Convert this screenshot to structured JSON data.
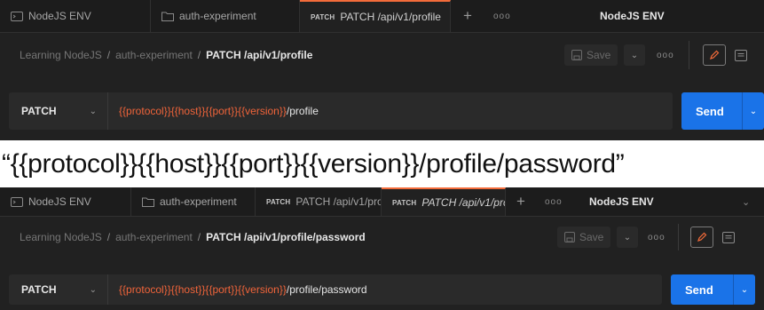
{
  "panel1": {
    "tabs": [
      {
        "label": "NodeJS ENV",
        "icon": "environment-icon"
      },
      {
        "label": "auth-experiment",
        "icon": "folder-icon"
      },
      {
        "method": "PATCH",
        "label": "PATCH /api/v1/profile",
        "active": true
      }
    ],
    "plus": "+",
    "dots": "ooo",
    "env_name": "NodeJS ENV",
    "breadcrumb": {
      "collection": "Learning NodeJS",
      "folder": "auth-experiment",
      "request": "PATCH /api/v1/profile"
    },
    "save_label": "Save",
    "method": "PATCH",
    "url": {
      "vars": "{{protocol}}{{host}}{{port}}{{version}}",
      "path": "/profile"
    },
    "send_label": "Send"
  },
  "caption": "“{{protocol}}{{host}}{{port}}{{version}}/profile/password”",
  "panel2": {
    "tabs": [
      {
        "label": "NodeJS ENV",
        "icon": "environment-icon"
      },
      {
        "label": "auth-experiment",
        "icon": "folder-icon"
      },
      {
        "method": "PATCH",
        "label": "PATCH /api/v1/pro"
      },
      {
        "method": "PATCH",
        "label": "PATCH /api/v1/pro",
        "active": true
      }
    ],
    "plus": "+",
    "dots": "ooo",
    "env_name": "NodeJS ENV",
    "breadcrumb": {
      "collection": "Learning NodeJS",
      "folder": "auth-experiment",
      "request": "PATCH /api/v1/profile/password"
    },
    "save_label": "Save",
    "method": "PATCH",
    "url": {
      "vars": "{{protocol}}{{host}}{{port}}{{version}}",
      "path": "/profile/password"
    },
    "send_label": "Send"
  },
  "colors": {
    "accent": "#f26b3a",
    "send": "#1a73e8",
    "variable": "#f0643a",
    "background": "#212121"
  }
}
